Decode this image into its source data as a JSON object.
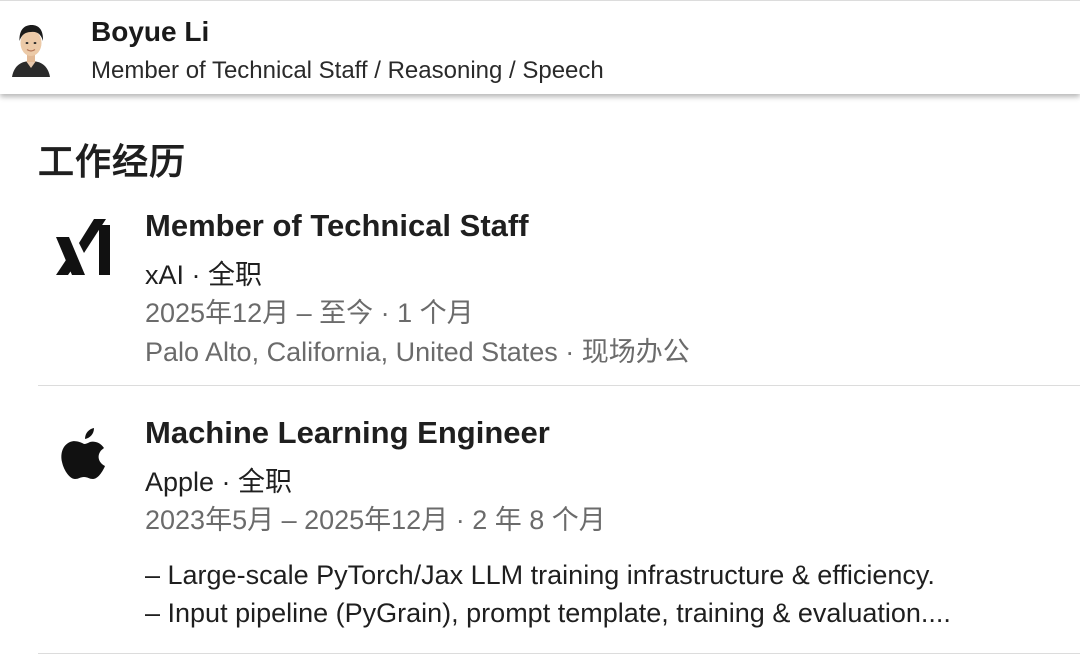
{
  "profile": {
    "avatar_icon": "person-avatar-icon",
    "name": "Boyue Li",
    "headline": "Member of Technical Staff / Reasoning / Speech"
  },
  "section": {
    "title": "工作经历"
  },
  "experiences": [
    {
      "logo_icon": "xai-logo-icon",
      "title": "Member of Technical Staff",
      "company_line": "xAI · 全职",
      "dates": "2025年12月 – 至今 · 1 个月",
      "location": "Palo Alto, California, United States · 现场办公"
    },
    {
      "logo_icon": "apple-logo-icon",
      "title": "Machine Learning Engineer",
      "company_line": "Apple · 全职",
      "dates": "2023年5月 – 2025年12月 · 2 年 8 个月",
      "description": [
        "– Large-scale PyTorch/Jax LLM training infrastructure & efficiency.",
        "– Input pipeline (PyGrain), prompt template, training & evaluation...."
      ]
    }
  ],
  "colors": {
    "text_primary": "#1f1f1f",
    "text_secondary": "#6b6b6b",
    "divider": "#dcdcdc",
    "background": "#ffffff"
  }
}
